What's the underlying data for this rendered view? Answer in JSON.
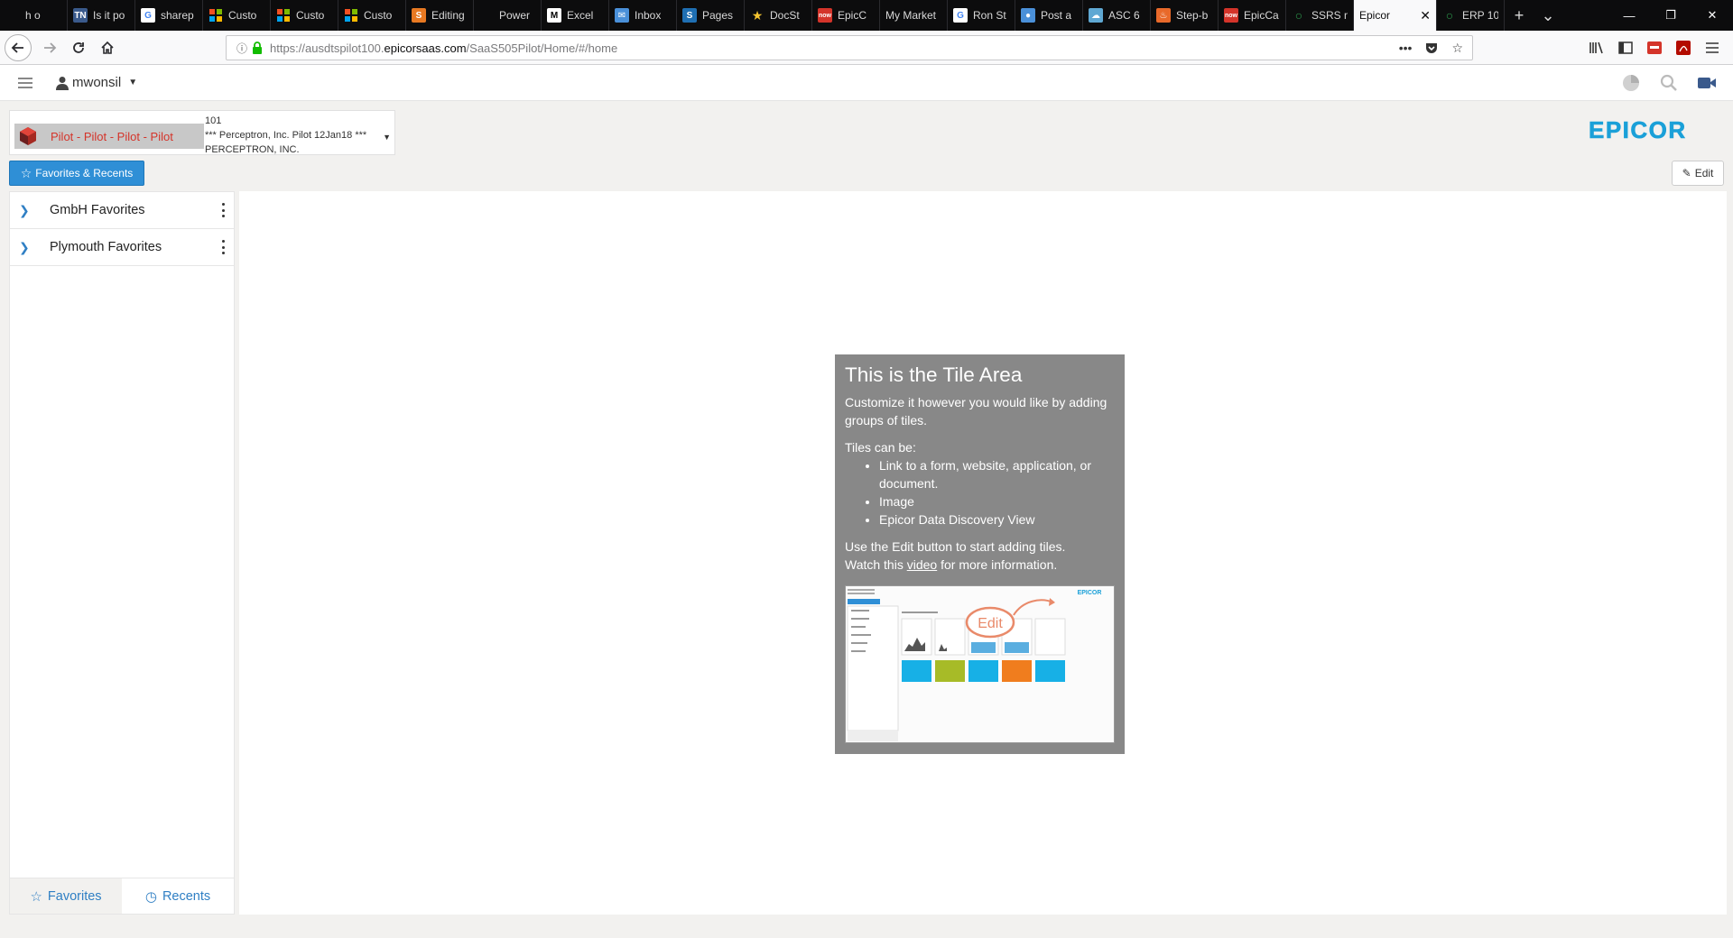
{
  "browser": {
    "tabs": [
      {
        "label": "h o",
        "icon": "partial-icon",
        "color": "#0c0c0d"
      },
      {
        "label": "Is it po",
        "icon": "tn-icon",
        "color": "#3a5a8c"
      },
      {
        "label": "sharep",
        "icon": "google-icon",
        "color": "#ffffff"
      },
      {
        "label": "Custo",
        "icon": "microsoft-icon",
        "color": "#f25022"
      },
      {
        "label": "Custo",
        "icon": "microsoft-icon",
        "color": "#f25022"
      },
      {
        "label": "Custo",
        "icon": "microsoft-icon",
        "color": "#f25022"
      },
      {
        "label": "Editing",
        "icon": "stackexchange-icon",
        "color": "#e87922"
      },
      {
        "label": "Power",
        "icon": "power-icon",
        "color": "#0c0c0d"
      },
      {
        "label": "Excel",
        "icon": "m-icon",
        "color": "#ffffff"
      },
      {
        "label": "Inbox",
        "icon": "mail-icon",
        "color": "#4a90d9"
      },
      {
        "label": "Pages",
        "icon": "sharepoint-icon",
        "color": "#1f6fb3"
      },
      {
        "label": "DocSt",
        "icon": "star-icon",
        "color": "#f4c430"
      },
      {
        "label": "EpicC",
        "icon": "now-icon",
        "color": "#d4342a"
      },
      {
        "label": "My Market",
        "icon": "none",
        "color": "#0c0c0d"
      },
      {
        "label": "Ron St",
        "icon": "google-icon",
        "color": "#ffffff"
      },
      {
        "label": "Post a",
        "icon": "globe-icon",
        "color": "#4a90d9"
      },
      {
        "label": "ASC 6",
        "icon": "cloud-icon",
        "color": "#5fa8d3"
      },
      {
        "label": "Step-b",
        "icon": "flame-icon",
        "color": "#e8692a"
      },
      {
        "label": "EpicCa",
        "icon": "now-icon",
        "color": "#d4342a"
      },
      {
        "label": "SSRS n",
        "icon": "circle-icon",
        "color": "#2e9e4f"
      },
      {
        "label": "Epicor",
        "icon": "none",
        "color": "#ffffff",
        "active": true
      },
      {
        "label": "ERP 10",
        "icon": "circle-icon",
        "color": "#2e9e4f"
      }
    ],
    "url_prefix": "https://ausdtspilot100.",
    "url_domain": "epicorsaas.com",
    "url_path": "/SaaS505Pilot/Home/#/home"
  },
  "app": {
    "username": "mwonsil",
    "company": {
      "site_label": "Pilot - Pilot - Pilot - Pilot",
      "line1": "101",
      "line2": "*** Perceptron, Inc. Pilot 12Jan18 ***",
      "line3": "PERCEPTRON, INC."
    },
    "brand": "EPICOR",
    "brand_color": "#1aa0d8",
    "favorites_button": "Favorites & Recents",
    "edit_button": "Edit",
    "sidebar_items": [
      {
        "label": "GmbH Favorites"
      },
      {
        "label": "Plymouth Favorites"
      }
    ],
    "sidebar_tabs": {
      "favorites": "Favorites",
      "recents": "Recents"
    }
  },
  "tile_info": {
    "title": "This is the Tile Area",
    "intro": "Customize it however you would like by adding groups of tiles.",
    "can_be": "Tiles can be:",
    "bullets": [
      "Link to a form, website, application, or document.",
      "Image",
      "Epicor Data Discovery View"
    ],
    "outro1": "Use the Edit button to start adding tiles.",
    "outro2_pre": "Watch this ",
    "outro2_link": "video",
    "outro2_post": " for more information.",
    "preview_edit": "Edit"
  }
}
